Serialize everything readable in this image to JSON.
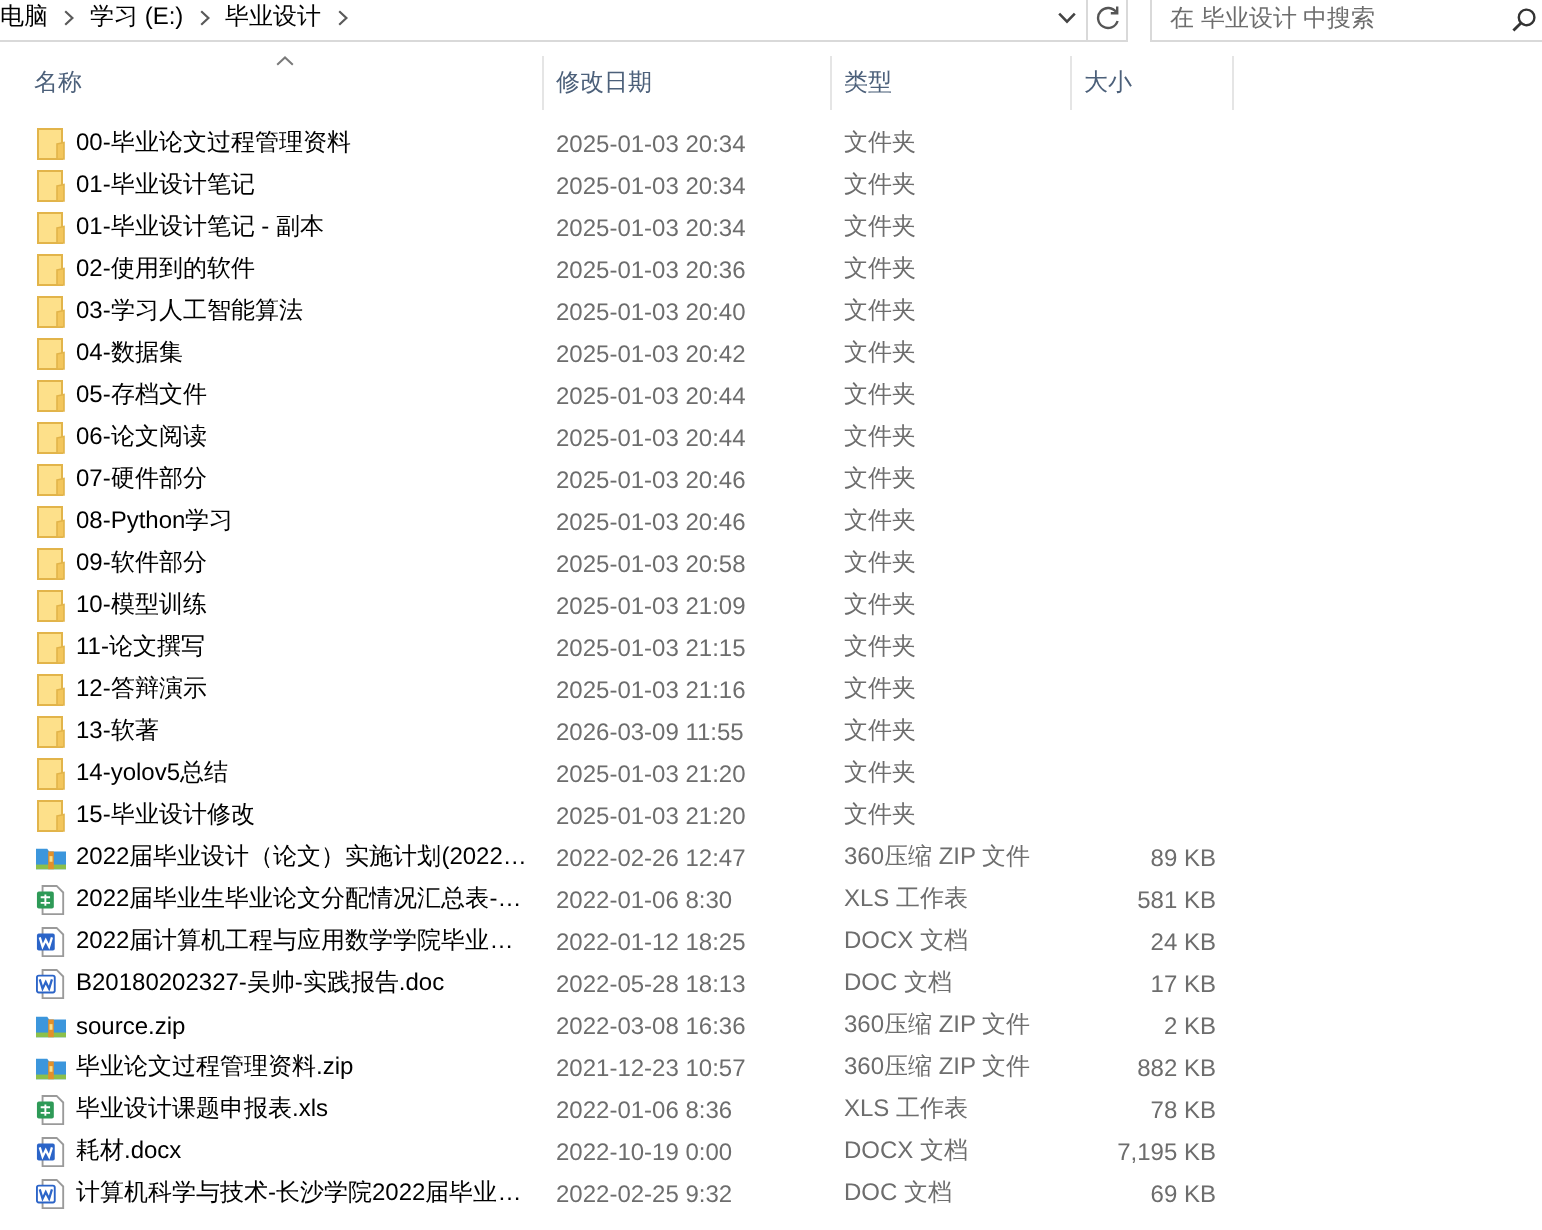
{
  "address_bar": {
    "breadcrumbs": [
      "电脑",
      "学习 (E:)",
      "毕业设计"
    ]
  },
  "search": {
    "placeholder": "在 毕业设计 中搜索"
  },
  "columns": [
    {
      "label": "名称",
      "sorted": true
    },
    {
      "label": "修改日期",
      "sorted": false
    },
    {
      "label": "类型",
      "sorted": false
    },
    {
      "label": "大小",
      "sorted": false
    }
  ],
  "rows": [
    {
      "kind": "folder",
      "name": "00-毕业论文过程管理资料",
      "modified": "2025-01-03 20:34",
      "type": "文件夹"
    },
    {
      "kind": "folder",
      "name": "01-毕业设计笔记",
      "modified": "2025-01-03 20:34",
      "type": "文件夹"
    },
    {
      "kind": "folder",
      "name": "01-毕业设计笔记 - 副本",
      "modified": "2025-01-03 20:34",
      "type": "文件夹"
    },
    {
      "kind": "folder",
      "name": "02-使用到的软件",
      "modified": "2025-01-03 20:36",
      "type": "文件夹"
    },
    {
      "kind": "folder",
      "name": "03-学习人工智能算法",
      "modified": "2025-01-03 20:40",
      "type": "文件夹"
    },
    {
      "kind": "folder",
      "name": "04-数据集",
      "modified": "2025-01-03 20:42",
      "type": "文件夹"
    },
    {
      "kind": "folder",
      "name": "05-存档文件",
      "modified": "2025-01-03 20:44",
      "type": "文件夹"
    },
    {
      "kind": "folder",
      "name": "06-论文阅读",
      "modified": "2025-01-03 20:44",
      "type": "文件夹"
    },
    {
      "kind": "folder",
      "name": "07-硬件部分",
      "modified": "2025-01-03 20:46",
      "type": "文件夹"
    },
    {
      "kind": "folder",
      "name": "08-Python学习",
      "modified": "2025-01-03 20:46",
      "type": "文件夹"
    },
    {
      "kind": "folder",
      "name": "09-软件部分",
      "modified": "2025-01-03 20:58",
      "type": "文件夹"
    },
    {
      "kind": "folder",
      "name": "10-模型训练",
      "modified": "2025-01-03 21:09",
      "type": "文件夹"
    },
    {
      "kind": "folder",
      "name": "11-论文撰写",
      "modified": "2025-01-03 21:15",
      "type": "文件夹"
    },
    {
      "kind": "folder",
      "name": "12-答辩演示",
      "modified": "2025-01-03 21:16",
      "type": "文件夹"
    },
    {
      "kind": "folder",
      "name": "13-软著",
      "modified": "2026-03-09 11:55",
      "type": "文件夹"
    },
    {
      "kind": "folder",
      "name": "14-yolov5总结",
      "modified": "2025-01-03 21:20",
      "type": "文件夹"
    },
    {
      "kind": "folder",
      "name": "15-毕业设计修改",
      "modified": "2025-01-03 21:20",
      "type": "文件夹"
    },
    {
      "kind": "zip",
      "name": "2022届毕业设计（论文）实施计划(2022…",
      "modified": "2022-02-26 12:47",
      "type": "360压缩 ZIP 文件",
      "size": "89 KB"
    },
    {
      "kind": "xls",
      "name": "2022届毕业生毕业论文分配情况汇总表-…",
      "modified": "2022-01-06 8:30",
      "type": "XLS 工作表",
      "size": "581 KB"
    },
    {
      "kind": "docx",
      "name": "2022届计算机工程与应用数学学院毕业…",
      "modified": "2022-01-12 18:25",
      "type": "DOCX 文档",
      "size": "24 KB"
    },
    {
      "kind": "doc",
      "name": "B20180202327-吴帅-实践报告.doc",
      "modified": "2022-05-28 18:13",
      "type": "DOC 文档",
      "size": "17 KB"
    },
    {
      "kind": "zip",
      "name": "source.zip",
      "modified": "2022-03-08 16:36",
      "type": "360压缩 ZIP 文件",
      "size": "2 KB"
    },
    {
      "kind": "zip",
      "name": "毕业论文过程管理资料.zip",
      "modified": "2021-12-23 10:57",
      "type": "360压缩 ZIP 文件",
      "size": "882 KB"
    },
    {
      "kind": "xls",
      "name": "毕业设计课题申报表.xls",
      "modified": "2022-01-06 8:36",
      "type": "XLS 工作表",
      "size": "78 KB"
    },
    {
      "kind": "docx",
      "name": "耗材.docx",
      "modified": "2022-10-19 0:00",
      "type": "DOCX 文档",
      "size": "7,195 KB"
    },
    {
      "kind": "doc",
      "name": "计算机科学与技术-长沙学院2022届毕业…",
      "modified": "2022-02-25 9:32",
      "type": "DOC 文档",
      "size": "69 KB"
    }
  ]
}
